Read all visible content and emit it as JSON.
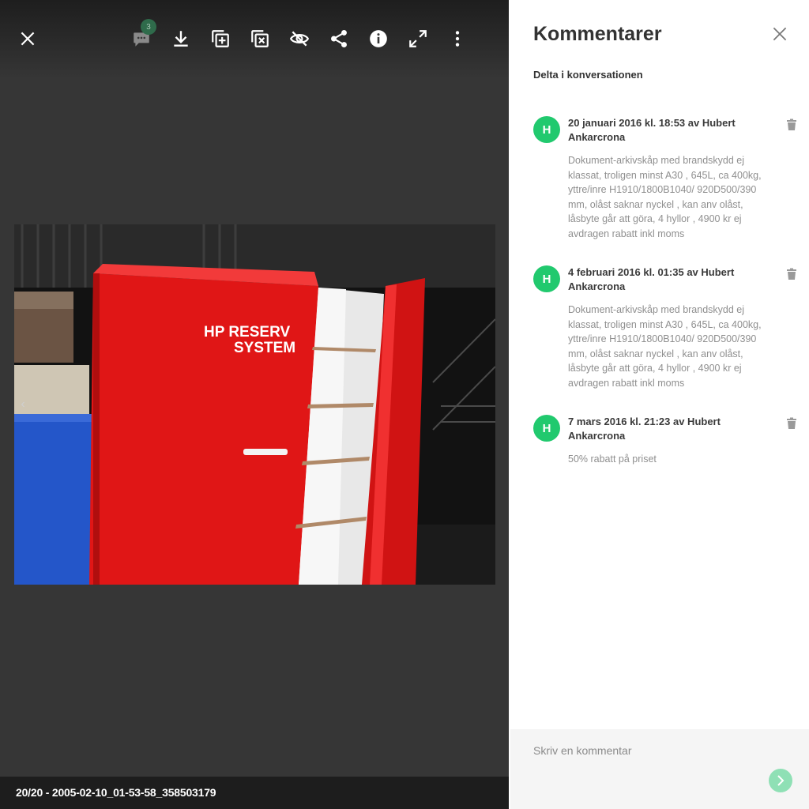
{
  "viewer": {
    "comment_count": "3",
    "caption": "20/20 - 2005-02-10_01-53-58_358503179",
    "photo_text_line1": "HP RESERV",
    "photo_text_line2": "SYSTEM",
    "toolbar_icons": [
      "close-icon",
      "comment-icon",
      "download-icon",
      "add-to-album-icon",
      "remove-from-album-icon",
      "hide-icon",
      "share-icon",
      "info-icon",
      "fullscreen-icon",
      "more-vertical-icon"
    ]
  },
  "panel": {
    "title": "Kommentarer",
    "subtitle": "Delta i konversationen",
    "comments": [
      {
        "initial": "H",
        "header": "20 januari 2016 kl. 18:53 av Hubert Ankarcrona",
        "body": "Dokument-arkivskåp med brandskydd ej klassat, troligen minst A30 , 645L, ca 400kg, yttre/inre H1910/1800B1040/ 920D500/390 mm, olåst saknar nyckel , kan anv olåst, låsbyte går att göra, 4 hyllor , 4900 kr ej avdragen rabatt inkl moms"
      },
      {
        "initial": "H",
        "header": "4 februari 2016 kl. 01:35 av Hubert Ankarcrona",
        "body": "Dokument-arkivskåp med brandskydd ej klassat, troligen minst A30 , 645L, ca 400kg, yttre/inre H1910/1800B1040/ 920D500/390 mm, olåst saknar nyckel , kan anv olåst, låsbyte går att göra, 4 hyllor , 4900 kr ej avdragen rabatt inkl moms"
      },
      {
        "initial": "H",
        "header": "7 mars 2016 kl. 21:23 av Hubert Ankarcrona",
        "body": "50% rabatt på priset"
      }
    ],
    "input_placeholder": "Skriv en kommentar"
  },
  "colors": {
    "avatar": "#21c96e",
    "send_button": "#8fe0b5",
    "viewer_bg": "#363636"
  }
}
